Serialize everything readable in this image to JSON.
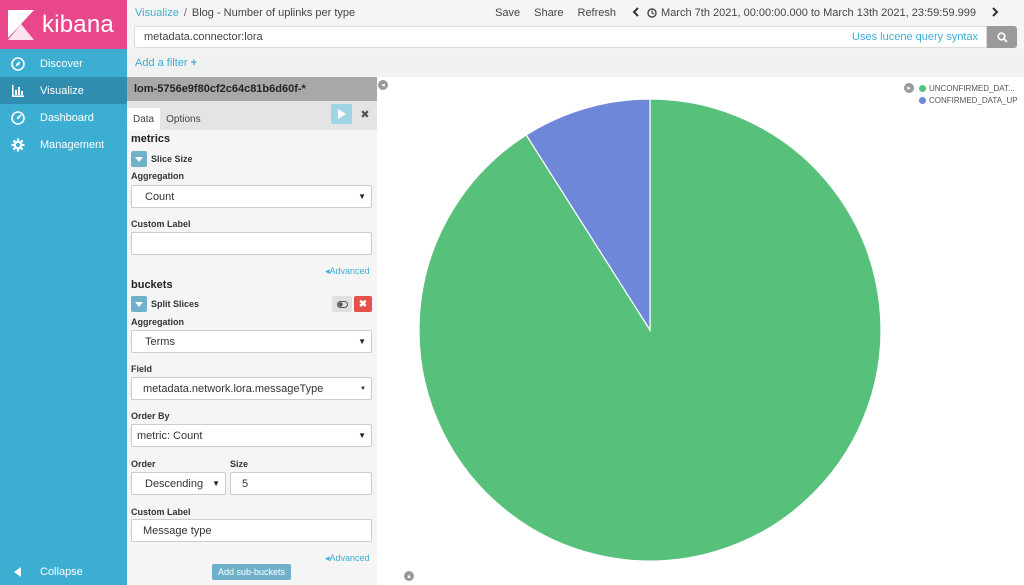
{
  "brand": {
    "name": "kibana",
    "logo_color": "#e8488b"
  },
  "sidebar": {
    "items": [
      {
        "label": "Discover",
        "icon": "compass-icon"
      },
      {
        "label": "Visualize",
        "icon": "bar-chart-icon",
        "active": true
      },
      {
        "label": "Dashboard",
        "icon": "dashboard-gauge-icon"
      },
      {
        "label": "Management",
        "icon": "gear-icon"
      }
    ],
    "collapse_label": "Collapse",
    "bg_color": "#3caed2"
  },
  "topbar": {
    "breadcrumb_root": "Visualize",
    "breadcrumb_sep": "/",
    "title": "Blog - Number of uplinks per type",
    "save": "Save",
    "share": "Share",
    "refresh": "Refresh",
    "time_range": "March 7th 2021, 00:00:00.000 to March 13th 2021, 23:59:59.999"
  },
  "query": {
    "value": "metadata.connector:lora",
    "syntax_link": "Uses lucene query syntax"
  },
  "filter": {
    "add_label": "Add a filter"
  },
  "editor": {
    "index_pattern": "lom-5756e9f80cf2c64c81b6d60f-*",
    "tabs": [
      "Data",
      "Options"
    ],
    "metrics": {
      "title": "metrics",
      "agg_name": "Slice Size",
      "aggregation_label": "Aggregation",
      "aggregation_value": "Count",
      "custom_label_label": "Custom Label",
      "custom_label_value": "",
      "advanced": "Advanced"
    },
    "buckets": {
      "title": "buckets",
      "agg_name": "Split Slices",
      "aggregation_label": "Aggregation",
      "aggregation_value": "Terms",
      "field_label": "Field",
      "field_value": "metadata.network.lora.messageType",
      "order_by_label": "Order By",
      "order_by_value": "metric: Count",
      "order_label": "Order",
      "order_value": "Descending",
      "size_label": "Size",
      "size_value": "5",
      "custom_label_label": "Custom Label",
      "custom_label_value": "Message type",
      "advanced": "Advanced"
    },
    "add_sub_buckets": "Add sub-buckets"
  },
  "chart_data": {
    "type": "pie",
    "slices": [
      {
        "label": "UNCONFIRMED_DAT...",
        "value": 91,
        "color": "#57c17b"
      },
      {
        "label": "CONFIRMED_DATA_UP",
        "value": 9,
        "color": "#6f87d8"
      }
    ]
  }
}
